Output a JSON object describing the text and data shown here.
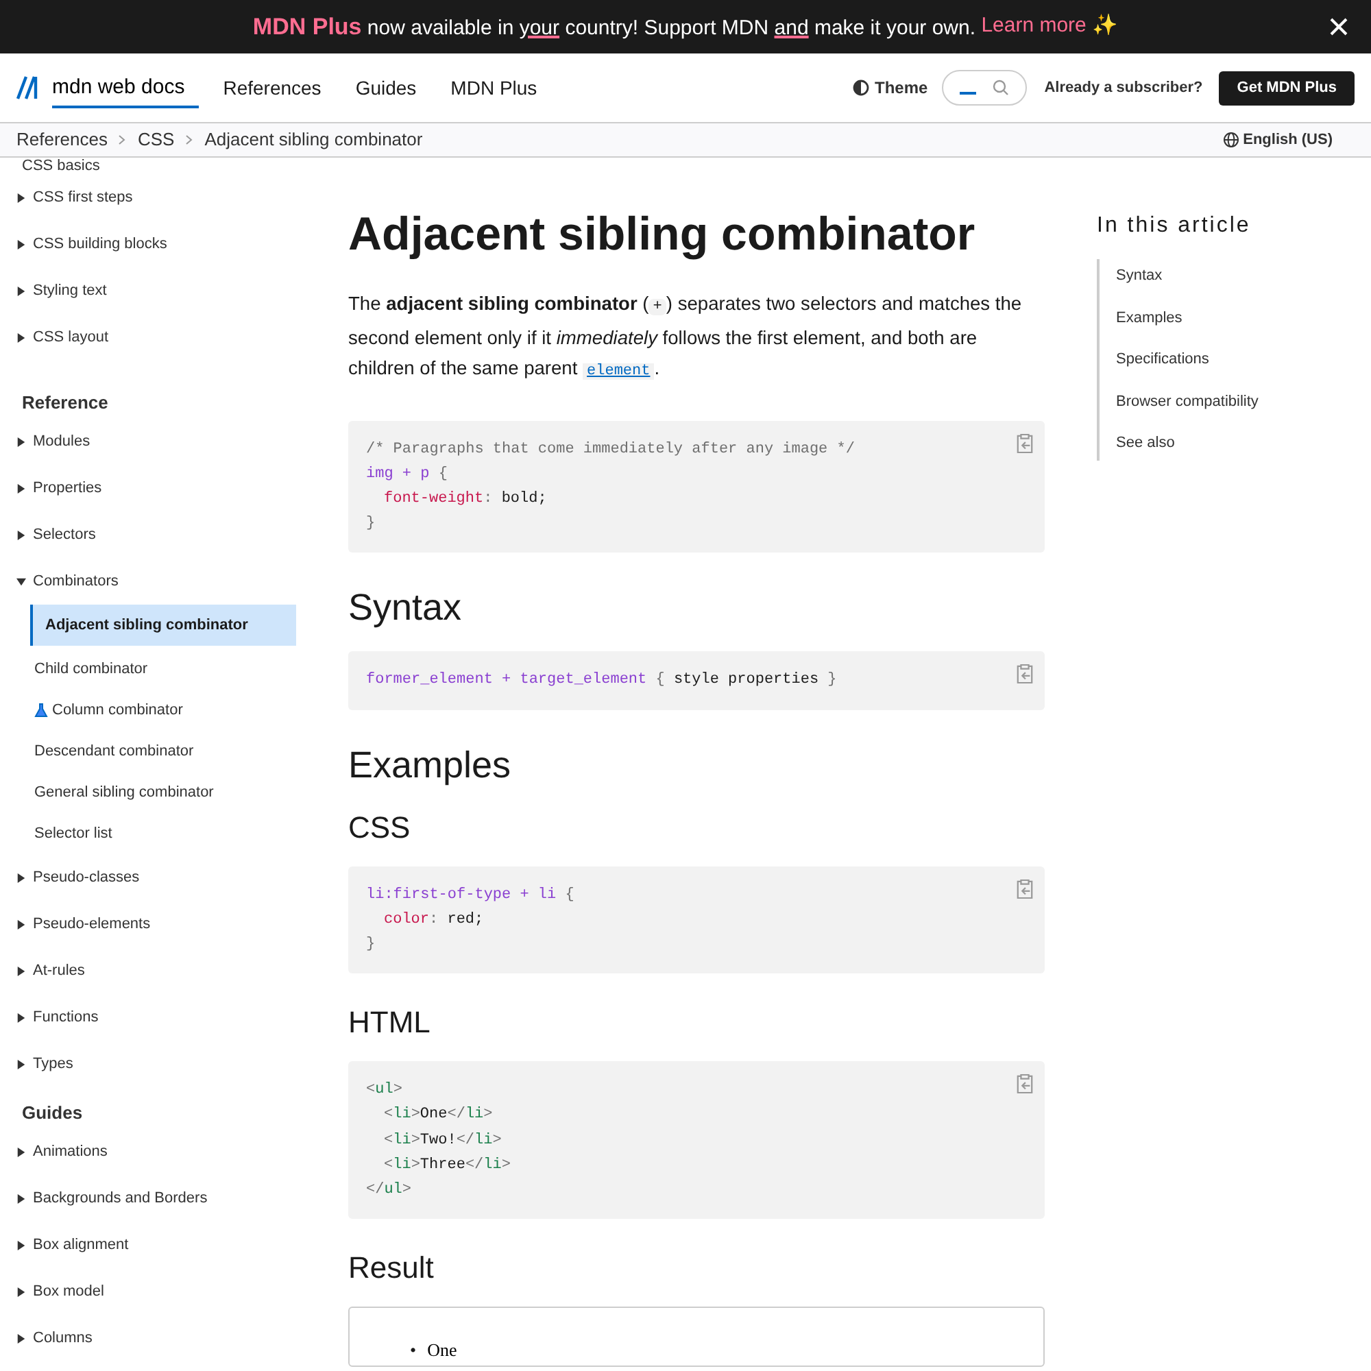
{
  "banner": {
    "segments": [
      {
        "kind": "brand",
        "text": "MDN Plus"
      },
      {
        "kind": "plain",
        "text": " now available in "
      },
      {
        "kind": "underline",
        "text": "your"
      },
      {
        "kind": "plain",
        "text": " country! Support MDN "
      },
      {
        "kind": "underline",
        "text": "and"
      },
      {
        "kind": "plain",
        "text": " make it your own. "
      }
    ],
    "link": "Learn more ✨"
  },
  "header": {
    "logo": "mdn web docs",
    "nav": [
      "References",
      "Guides",
      "MDN Plus"
    ],
    "theme": "Theme",
    "subscriber": "Already a subscriber?",
    "cta": "Get MDN Plus"
  },
  "breadcrumbs": [
    "References",
    "CSS",
    "Adjacent sibling combinator"
  ],
  "language": "English (US)",
  "sidebar": [
    {
      "kind": "item",
      "label": "CSS basics"
    },
    {
      "kind": "group",
      "label": "CSS first steps",
      "expanded": false
    },
    {
      "kind": "group",
      "label": "CSS building blocks",
      "expanded": false
    },
    {
      "kind": "group",
      "label": "Styling text",
      "expanded": false
    },
    {
      "kind": "group",
      "label": "CSS layout",
      "expanded": false
    },
    {
      "kind": "heading",
      "label": "Reference"
    },
    {
      "kind": "group",
      "label": "Modules",
      "expanded": false
    },
    {
      "kind": "group",
      "label": "Properties",
      "expanded": false
    },
    {
      "kind": "group",
      "label": "Selectors",
      "expanded": false
    },
    {
      "kind": "group",
      "label": "Combinators",
      "expanded": true,
      "children": [
        {
          "label": "Adjacent sibling combinator",
          "selected": true,
          "experimental": false
        },
        {
          "label": "Child combinator",
          "selected": false,
          "experimental": false
        },
        {
          "label": "Column combinator",
          "selected": false,
          "experimental": true
        },
        {
          "label": "Descendant combinator",
          "selected": false,
          "experimental": false
        },
        {
          "label": "General sibling combinator",
          "selected": false,
          "experimental": false
        },
        {
          "label": "Selector list",
          "selected": false,
          "experimental": false
        }
      ]
    },
    {
      "kind": "group",
      "label": "Pseudo-classes",
      "expanded": false
    },
    {
      "kind": "group",
      "label": "Pseudo-elements",
      "expanded": false
    },
    {
      "kind": "group",
      "label": "At-rules",
      "expanded": false
    },
    {
      "kind": "group",
      "label": "Functions",
      "expanded": false
    },
    {
      "kind": "group",
      "label": "Types",
      "expanded": false
    },
    {
      "kind": "heading",
      "label": "Guides"
    },
    {
      "kind": "group",
      "label": "Animations",
      "expanded": false
    },
    {
      "kind": "group",
      "label": "Backgrounds and Borders",
      "expanded": false
    },
    {
      "kind": "group",
      "label": "Box alignment",
      "expanded": false
    },
    {
      "kind": "group",
      "label": "Box model",
      "expanded": false
    },
    {
      "kind": "group",
      "label": "Columns",
      "expanded": false
    }
  ],
  "article": {
    "title": "Adjacent sibling combinator",
    "blocks": [
      {
        "kind": "paragraph",
        "segments": [
          {
            "kind": "plain",
            "text": "The "
          },
          {
            "kind": "bold",
            "text": "adjacent sibling combinator"
          },
          {
            "kind": "plain",
            "text": " ("
          },
          {
            "kind": "code",
            "text": "+"
          },
          {
            "kind": "plain",
            "text": ") separates two selectors and matches the second element only if it "
          },
          {
            "kind": "italic",
            "text": "immediately"
          },
          {
            "kind": "plain",
            "text": " follows the first element, and both are children of the same parent "
          },
          {
            "kind": "codelink",
            "text": "element"
          },
          {
            "kind": "plain",
            "text": "."
          }
        ]
      },
      {
        "kind": "code",
        "lines": [
          {
            "indented": false,
            "tokens": [
              {
                "kind": "comment",
                "t": "/* Paragraphs that come immediately after any image */"
              }
            ]
          },
          {
            "indented": false,
            "tokens": [
              {
                "kind": "selector",
                "t": "img + p "
              },
              {
                "kind": "punct",
                "t": "{"
              }
            ]
          },
          {
            "indented": true,
            "tokens": [
              {
                "kind": "property",
                "t": "font-weight"
              },
              {
                "kind": "punct",
                "t": ": "
              },
              {
                "kind": "value",
                "t": "bold;"
              }
            ]
          },
          {
            "indented": false,
            "tokens": [
              {
                "kind": "punct",
                "t": "}"
              }
            ]
          }
        ]
      },
      {
        "kind": "h2",
        "text": "Syntax"
      },
      {
        "kind": "code",
        "lines": [
          {
            "indented": false,
            "tokens": [
              {
                "kind": "selector",
                "t": "former_element + target_element "
              },
              {
                "kind": "punct",
                "t": "{ "
              },
              {
                "kind": "value",
                "t": "style properties "
              },
              {
                "kind": "punct",
                "t": "}"
              }
            ]
          }
        ]
      },
      {
        "kind": "h2",
        "text": "Examples"
      },
      {
        "kind": "h3",
        "text": "CSS"
      },
      {
        "kind": "code",
        "lines": [
          {
            "indented": false,
            "tokens": [
              {
                "kind": "selector",
                "t": "li:first-of-type + li "
              },
              {
                "kind": "punct",
                "t": "{"
              }
            ]
          },
          {
            "indented": true,
            "tokens": [
              {
                "kind": "property",
                "t": "color"
              },
              {
                "kind": "punct",
                "t": ": "
              },
              {
                "kind": "value",
                "t": "red;"
              }
            ]
          },
          {
            "indented": false,
            "tokens": [
              {
                "kind": "punct",
                "t": "}"
              }
            ]
          }
        ]
      },
      {
        "kind": "h3",
        "text": "HTML"
      },
      {
        "kind": "code",
        "lines": [
          {
            "indented": false,
            "tokens": [
              {
                "kind": "punct",
                "t": "<"
              },
              {
                "kind": "tag",
                "t": "ul"
              },
              {
                "kind": "punct",
                "t": ">"
              }
            ]
          },
          {
            "indented": true,
            "tokens": [
              {
                "kind": "punct",
                "t": "<"
              },
              {
                "kind": "tag",
                "t": "li"
              },
              {
                "kind": "punct",
                "t": ">"
              },
              {
                "kind": "value",
                "t": "One"
              },
              {
                "kind": "punct",
                "t": "</"
              },
              {
                "kind": "tag",
                "t": "li"
              },
              {
                "kind": "punct",
                "t": ">"
              }
            ]
          },
          {
            "indented": true,
            "tokens": [
              {
                "kind": "punct",
                "t": "<"
              },
              {
                "kind": "tag",
                "t": "li"
              },
              {
                "kind": "punct",
                "t": ">"
              },
              {
                "kind": "value",
                "t": "Two!"
              },
              {
                "kind": "punct",
                "t": "</"
              },
              {
                "kind": "tag",
                "t": "li"
              },
              {
                "kind": "punct",
                "t": ">"
              }
            ]
          },
          {
            "indented": true,
            "tokens": [
              {
                "kind": "punct",
                "t": "<"
              },
              {
                "kind": "tag",
                "t": "li"
              },
              {
                "kind": "punct",
                "t": ">"
              },
              {
                "kind": "value",
                "t": "Three"
              },
              {
                "kind": "punct",
                "t": "</"
              },
              {
                "kind": "tag",
                "t": "li"
              },
              {
                "kind": "punct",
                "t": ">"
              }
            ]
          },
          {
            "indented": false,
            "tokens": [
              {
                "kind": "punct",
                "t": "</"
              },
              {
                "kind": "tag",
                "t": "ul"
              },
              {
                "kind": "punct",
                "t": ">"
              }
            ]
          }
        ]
      },
      {
        "kind": "h3",
        "text": "Result"
      },
      {
        "kind": "result",
        "items": [
          {
            "marker": "•",
            "text": "One",
            "color": "#000000"
          }
        ]
      }
    ]
  },
  "toc": {
    "title": "In this article",
    "items": [
      "Syntax",
      "Examples",
      "Specifications",
      "Browser compatibility",
      "See also"
    ]
  }
}
